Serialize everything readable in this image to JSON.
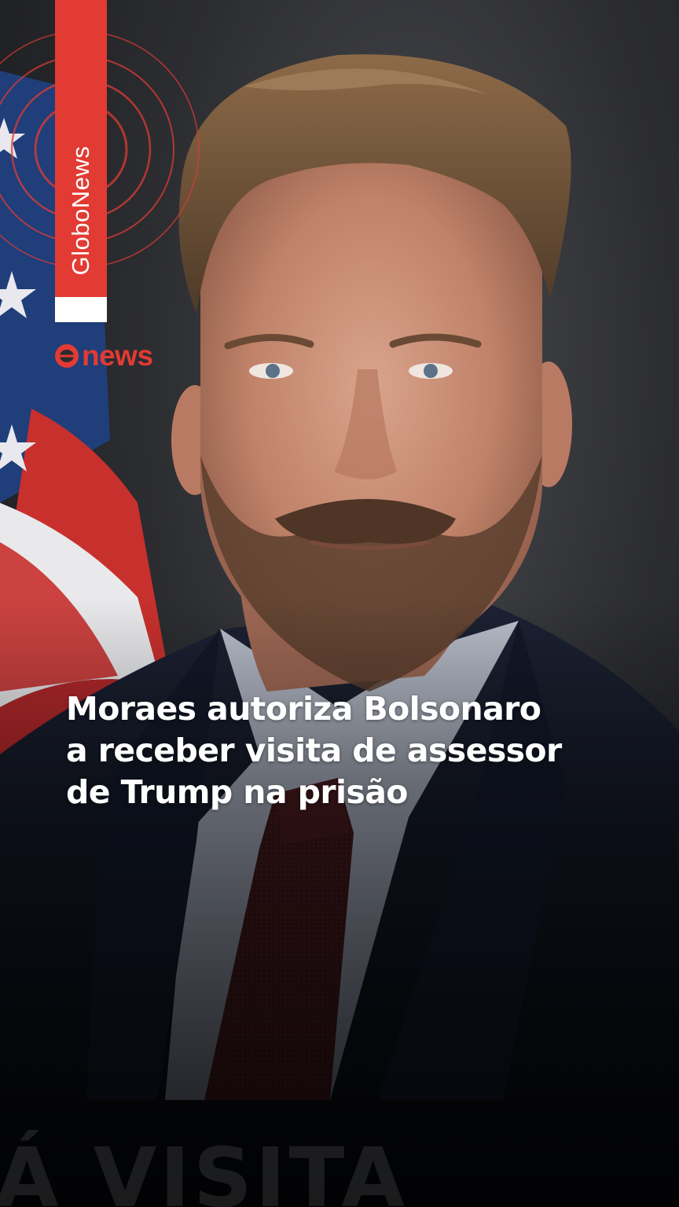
{
  "brand": {
    "vertical_label": "GloboNews",
    "logo_text": "news",
    "accent_color": "#e13b33"
  },
  "headline": {
    "lines": [
      "Moraes autoriza Bolsonaro",
      "a receber visita de assessor",
      "de Trump na prisão"
    ]
  },
  "background_caption": "Á VISITA",
  "scene": {
    "subject": "portrait of bearded man in dark suit and maroon tie",
    "background_flag": "us-flag-icon"
  }
}
